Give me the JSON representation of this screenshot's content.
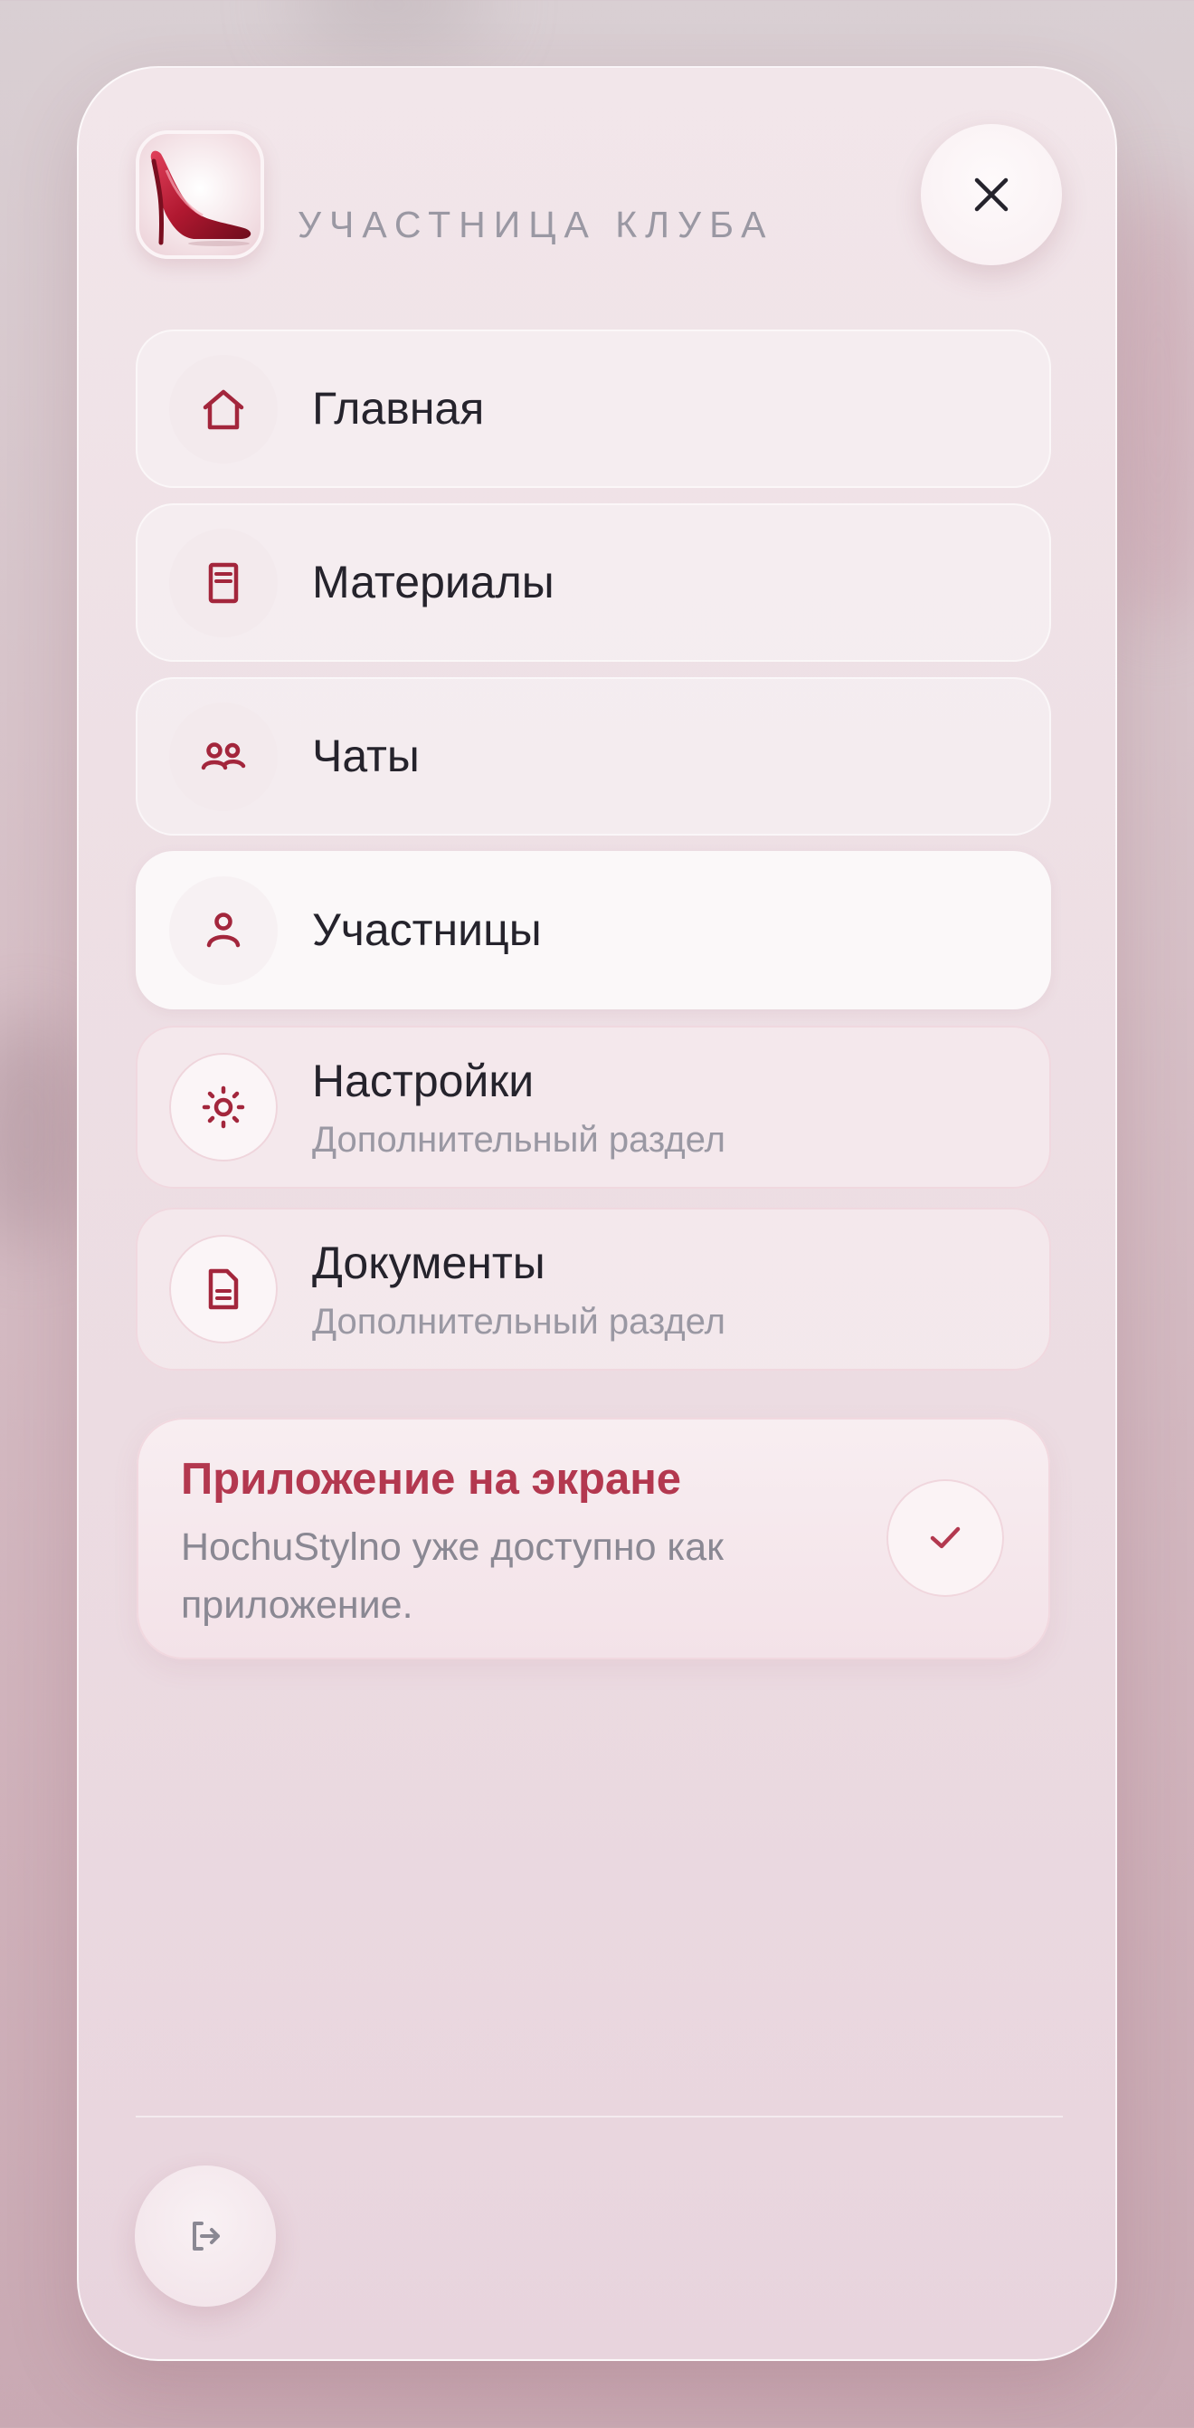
{
  "header": {
    "club_label": "УЧАСТНИЦА КЛУБА",
    "logo_icon": "high-heel-shoe-icon",
    "close_icon": "close-icon"
  },
  "nav": {
    "items": [
      {
        "label": "Главная",
        "icon": "home-icon"
      },
      {
        "label": "Материалы",
        "icon": "book-icon"
      },
      {
        "label": "Чаты",
        "icon": "users-icon"
      },
      {
        "label": "Участницы",
        "icon": "user-icon",
        "active": true
      },
      {
        "label": "Настройки",
        "sub": "Дополнительный раздел",
        "icon": "sun-icon"
      },
      {
        "label": "Документы",
        "sub": "Дополнительный раздел",
        "icon": "document-icon"
      }
    ]
  },
  "install": {
    "title": "Приложение на экране",
    "text": "HochuStylno уже доступно как приложение.",
    "icon": "check-icon"
  },
  "footer": {
    "logout_icon": "logout-icon"
  },
  "colors": {
    "accent": "#a3263c",
    "accent_title": "#b3384f",
    "text": "#25232c",
    "muted": "#9a98a3"
  }
}
